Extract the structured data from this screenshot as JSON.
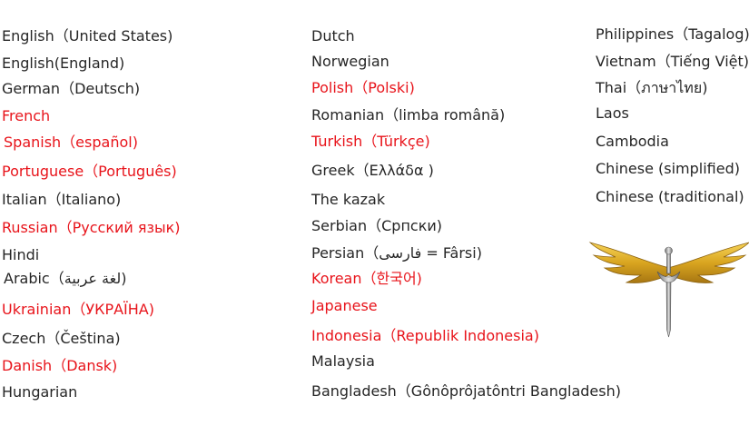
{
  "colors": {
    "highlight": "#e8141b",
    "text": "#262626"
  },
  "columns": [
    [
      {
        "label": "English（United States)",
        "highlight": false
      },
      {
        "label": "English(England)",
        "highlight": false
      },
      {
        "label": "German（Deutsch)",
        "highlight": false
      },
      {
        "label": "French",
        "highlight": true
      },
      {
        "label": "Spanish（español)",
        "highlight": true
      },
      {
        "label": "Portuguese（Português)",
        "highlight": true
      },
      {
        "label": "Italian（Italiano)",
        "highlight": false
      },
      {
        "label": "Russian（Русский язык)",
        "highlight": true
      },
      {
        "label": "Hindi",
        "highlight": false
      },
      {
        "label": "Arabic（لغة عربية)",
        "highlight": false
      },
      {
        "label": "Ukrainian（УКРАЇНА)",
        "highlight": true
      },
      {
        "label": "Czech（Čeština)",
        "highlight": false
      },
      {
        "label": "Danish（Dansk)",
        "highlight": true
      },
      {
        "label": "Hungarian",
        "highlight": false
      }
    ],
    [
      {
        "label": "Dutch",
        "highlight": false
      },
      {
        "label": "Norwegian",
        "highlight": false
      },
      {
        "label": "Polish（Polski)",
        "highlight": true
      },
      {
        "label": "Romanian（limba română)",
        "highlight": false
      },
      {
        "label": "Turkish（Türkçe)",
        "highlight": true
      },
      {
        "label": "Greek（Ελλάδα )",
        "highlight": false
      },
      {
        "label": "The kazak",
        "highlight": false
      },
      {
        "label": "Serbian（Српски)",
        "highlight": false
      },
      {
        "label": "Persian（فارسی = Fârsi)",
        "highlight": false
      },
      {
        "label": "Korean（한국어)",
        "highlight": true
      },
      {
        "label": "Japanese",
        "highlight": true
      },
      {
        "label": "Indonesia（Republik Indonesia)",
        "highlight": true
      },
      {
        "label": "Malaysia",
        "highlight": false
      },
      {
        "label": "Bangladesh（Gônôprôjatôntri Bangladesh)",
        "highlight": false
      }
    ],
    [
      {
        "label": "Philippines（Tagalog)",
        "highlight": false
      },
      {
        "label": "Vietnam（Tiếng Việt)",
        "highlight": false
      },
      {
        "label": "Thai（ภาษาไทย)",
        "highlight": false
      },
      {
        "label": "Laos",
        "highlight": false
      },
      {
        "label": "Cambodia",
        "highlight": false
      },
      {
        "label": "Chinese (simplified)",
        "highlight": false
      },
      {
        "label": "Chinese (traditional)",
        "highlight": false
      }
    ]
  ]
}
